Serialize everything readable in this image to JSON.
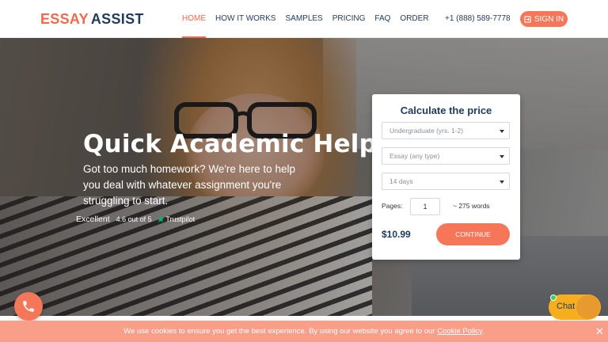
{
  "header": {
    "logo_part1": "ESSAY",
    "logo_part2": "ASSIST",
    "nav": [
      "HOME",
      "HOW IT WORKS",
      "SAMPLES",
      "PRICING",
      "FAQ",
      "ORDER"
    ],
    "active_nav": "HOME",
    "phone": "+1 (888) 589-7778",
    "signin_label": "SIGN IN"
  },
  "hero": {
    "title": "Quick Academic Help",
    "text": "Got too much homework? We're here to help you deal with whatever assignment you're struggling to start.",
    "trust_excellent": "Excellent",
    "trust_rating": "4.6 out of 5",
    "trust_brand": "Trustpilot"
  },
  "calculator": {
    "title": "Calculate the price",
    "level": "Undergraduate (yrs. 1-2)",
    "paper_type": "Essay (any type)",
    "deadline": "14 days",
    "pages_label": "Pages:",
    "pages_value": "1",
    "words": "~ 275 words",
    "price": "$10.99",
    "continue_label": "CONTINUE"
  },
  "chat": {
    "label": "Chat"
  },
  "cookie": {
    "message": "We use cookies to ensure you get the best experience. By using our website you agree to our",
    "link": "Cookie Policy",
    "end": "."
  },
  "colors": {
    "accent": "#f6765a",
    "navy": "#1f3a5c",
    "chat": "#f6ae1e",
    "cookie_bar": "#f99f89"
  },
  "icons": [
    "sign-in-icon",
    "phone-icon",
    "star-icon",
    "close-icon",
    "caret-down-icon"
  ]
}
